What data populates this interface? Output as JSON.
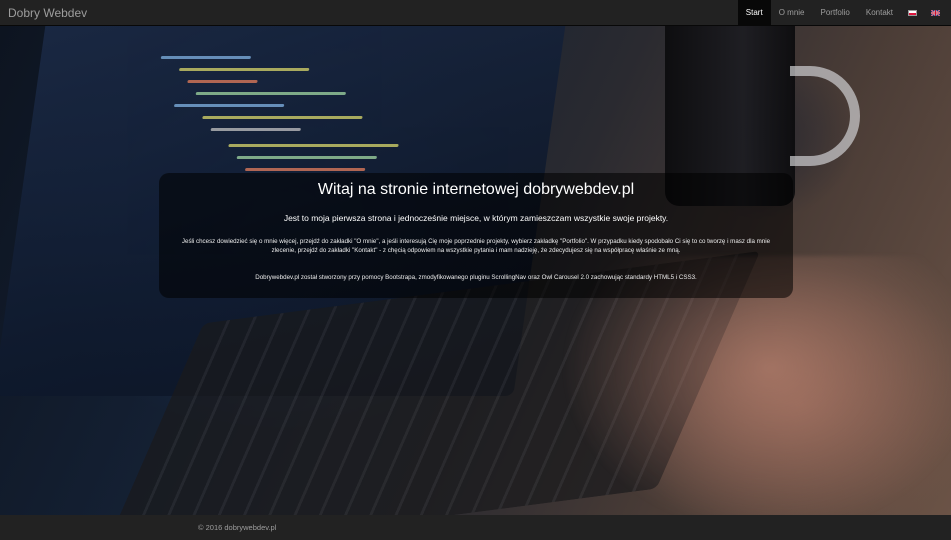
{
  "navbar": {
    "brand": "Dobry Webdev",
    "items": [
      {
        "label": "Start",
        "active": true
      },
      {
        "label": "O mnie",
        "active": false
      },
      {
        "label": "Portfolio",
        "active": false
      },
      {
        "label": "Kontakt",
        "active": false
      }
    ],
    "languages": [
      {
        "icon": "flag-poland-icon"
      },
      {
        "icon": "flag-uk-icon"
      }
    ]
  },
  "welcome": {
    "title": "Witaj na stronie internetowej dobrywebdev.pl",
    "lead": "Jest to moja pierwsza strona i jednocześnie miejsce, w którym zamieszczam wszystkie swoje projekty.",
    "text": "Jeśli chcesz dowiedzieć się o mnie więcej, przejdź do zakładki \"O mnie\", a jeśli interesują Cię moje poprzednie projekty, wybierz zakładkę \"Portfolio\". W przypadku kiedy spodobało Ci się to co tworzę i masz dla mnie zlecenie, przejdź do zakładki \"Kontakt\" - z chęcią odpowiem na wszystkie pytania i mam nadzieję, że zdecydujesz się na współpracę właśnie ze mną.",
    "tech": "Dobrywebdev.pl został stworzony przy pomocy Bootstrapa, zmodyfikowanego pluginu ScrollingNav oraz Owl Carousel 2.0 zachowując standardy HTML5 i CSS3."
  },
  "footer": {
    "copyright": "© 2016 dobrywebdev.pl"
  },
  "colors": {
    "navbar_bg": "#222222",
    "active_bg": "#080808",
    "nav_text": "#9d9d9d"
  }
}
